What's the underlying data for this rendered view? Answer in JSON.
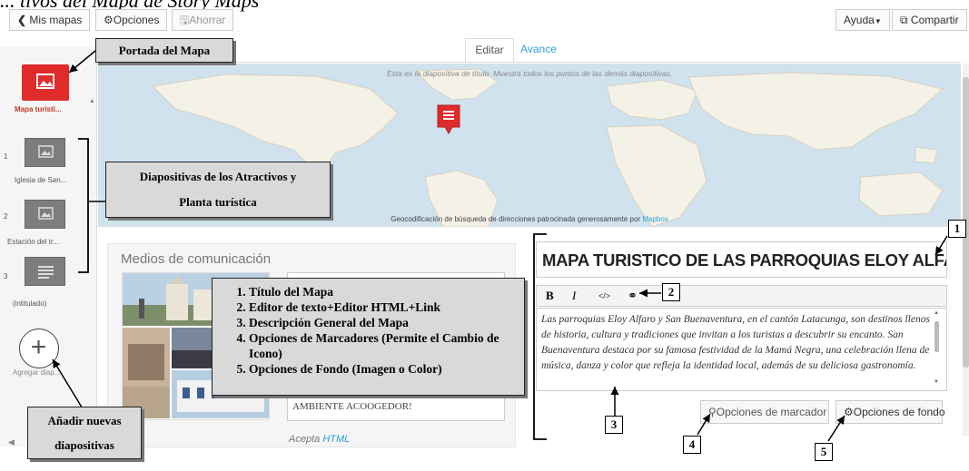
{
  "page_heading": "... tivos del Mapa de Story Maps",
  "toolbar": {
    "back_label": "Mis mapas",
    "options_label": "Opciones",
    "save_label": "Ahorrar",
    "help_label": "Ayuda",
    "share_label": "Compartir"
  },
  "tabs": {
    "edit": "Editar",
    "preview": "Avance"
  },
  "map": {
    "hint": "Esta es la diapositiva de título. Muestra todos los puntos de las demás diapositivas.",
    "attribution_text": "Geocodificación de búsqueda de direcciones patrocinada generosamente por",
    "attribution_link": "Mapbox"
  },
  "sidebar": {
    "slides": [
      {
        "num": "",
        "label": "Mapa turísti..."
      },
      {
        "num": "1",
        "label": "Iglesia de San..."
      },
      {
        "num": "2",
        "label": "Estación del tr..."
      },
      {
        "num": "3",
        "label": "(intitulado)"
      }
    ],
    "add_label": "Agregar diap..."
  },
  "media": {
    "heading": "Medios de comunicación",
    "caption_text": "AMBIENTE ACOOGEDOR!",
    "accepts_text": "Acepta",
    "accepts_link": "HTML"
  },
  "editor": {
    "title": "MAPA TURISTICO DE LAS PARROQUIAS ELOY ALFARO Y SA",
    "bold": "B",
    "italic": "I",
    "html": "</>",
    "description": "Las parroquias Eloy Alfaro y San Buenaventura, en el cantón Latacunga, son destinos llenos de historia, cultura y tradiciones que invitan a los turistas a descubrir su encanto. San Buenaventura destaca por su famosa festividad de la Mamá Negra, una celebración llena de música, danza y color que refleja la identidad local, además de su deliciosa gastronomía.",
    "marker_options": "Opciones de marcador",
    "background_options": "Opciones de fondo"
  },
  "annotations": {
    "cover": "Portada del Mapa",
    "slides_line1": "Diapositivas de los Atractivos y",
    "slides_line2": "Planta turística",
    "add_line1": "Añadir nuevas",
    "add_line2": "diapositivas",
    "list": [
      "Título del Mapa",
      "Editor de texto+Editor HTML+Link",
      "Descripción General del Mapa",
      "Opciones de Marcadores (Permite el Cambio de Icono)",
      "Opciones de Fondo (Imagen o Color)"
    ],
    "n1": "1",
    "n2": "2",
    "n3": "3",
    "n4": "4",
    "n5": "5"
  }
}
